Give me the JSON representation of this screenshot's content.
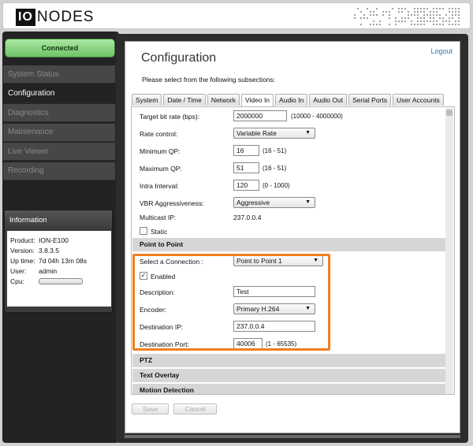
{
  "header": {
    "logo_box": "IO",
    "logo_text": "NODES"
  },
  "status": {
    "connected_label": "Connected"
  },
  "nav": {
    "items": [
      {
        "label": "System Status"
      },
      {
        "label": "Configuration"
      },
      {
        "label": "Diagnostics"
      },
      {
        "label": "Maintenance"
      },
      {
        "label": "Live Viewer"
      },
      {
        "label": "Recording"
      }
    ],
    "active_index": 1
  },
  "info": {
    "title": "Information",
    "product_key": "Product:",
    "product": "ION-E100",
    "version_key": "Version:",
    "version": "3.8.3.5",
    "uptime_key": "Up time:",
    "uptime": "7d 04h 13m 08s",
    "user_key": "User:",
    "user": "admin",
    "cpu_key": "Cpu:"
  },
  "main": {
    "title": "Configuration",
    "logout": "Logout",
    "subtitle": "Please select from the following subsections:",
    "tabs": [
      "System",
      "Date / Time",
      "Network",
      "Video In",
      "Audio In",
      "Audio Out",
      "Serial Ports",
      "User Accounts"
    ],
    "active_tab": "Video In"
  },
  "video": {
    "bitrate_label": "Target bit rate (bps):",
    "bitrate_value": "2000000",
    "bitrate_hint": "(10000 - 4000000)",
    "rate_control_label": "Rate control:",
    "rate_control_value": "Variable Rate",
    "min_qp_label": "Minimum QP:",
    "min_qp_value": "16",
    "min_qp_hint": "(16 - 51)",
    "max_qp_label": "Maximum QP:",
    "max_qp_value": "51",
    "max_qp_hint": "(16 - 51)",
    "intra_label": "Intra Interval:",
    "intra_value": "120",
    "intra_hint": "(0 - 1000)",
    "vbr_label": "VBR Aggressiveness:",
    "vbr_value": "Aggressive",
    "multicast_label": "Multicast IP:",
    "multicast_value": "237.0.0.4",
    "static_label": "Static"
  },
  "p2p": {
    "section": "Point to Point",
    "select_label": "Select a Connection :",
    "select_value": "Point to Point 1",
    "enabled_label": "Enabled",
    "enabled_check": "✓",
    "desc_label": "Description:",
    "desc_value": "Test",
    "encoder_label": "Encoder:",
    "encoder_value": "Primary H.264",
    "dest_ip_label": "Destination IP:",
    "dest_ip_value": "237.0.0.4",
    "dest_port_label": "Destination Port:",
    "dest_port_value": "40006",
    "dest_port_hint": "(1 - 65535)"
  },
  "sections": {
    "ptz": "PTZ",
    "overlay": "Text Overlay",
    "motion": "Motion Detection"
  },
  "buttons": {
    "save": "Save",
    "cancel": "Cancel"
  }
}
